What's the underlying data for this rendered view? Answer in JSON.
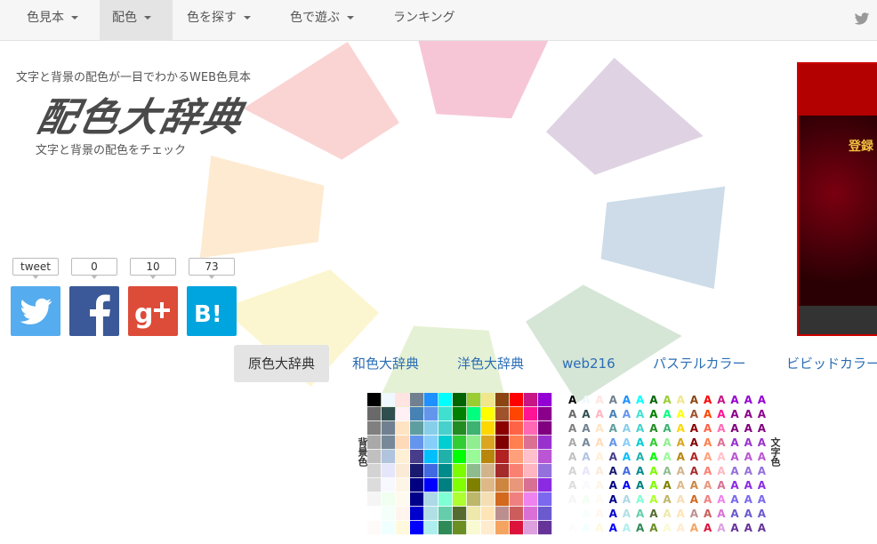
{
  "nav": {
    "items": [
      {
        "label": "色見本",
        "dropdown": true
      },
      {
        "label": "配色",
        "dropdown": true,
        "active": true
      },
      {
        "label": "色を探す",
        "dropdown": true
      },
      {
        "label": "色で遊ぶ",
        "dropdown": true
      },
      {
        "label": "ランキング",
        "dropdown": false
      }
    ],
    "right_icon": "twitter-icon"
  },
  "header": {
    "tagline": "文字と背景の配色が一目でわかるWEB色見本",
    "logo": "配色大辞典",
    "subtitle": "文字と背景の配色をチェック"
  },
  "social": [
    {
      "label": "tweet",
      "icon": "twitter-icon",
      "color": "#55acee"
    },
    {
      "label": "0",
      "icon": "facebook-icon",
      "color": "#3b5998"
    },
    {
      "label": "10",
      "icon": "google-plus-icon",
      "color": "#dd4b39"
    },
    {
      "label": "73",
      "icon": "hatena-bookmark-icon",
      "color": "#00a4de"
    }
  ],
  "tabs": [
    {
      "label": "原色大辞典",
      "active": true
    },
    {
      "label": "和色大辞典"
    },
    {
      "label": "洋色大辞典"
    },
    {
      "label": "web216"
    },
    {
      "label": "パステルカラー"
    },
    {
      "label": "ビビッドカラー"
    }
  ],
  "palette": {
    "background_label": "背景色",
    "text_label": "文字色",
    "sample_char": "A",
    "columns": [
      [
        "#000000",
        "#696969",
        "#808080",
        "#a9a9a9",
        "#c0c0c0",
        "#d3d3d3",
        "#dcdcdc",
        "#f5f5f5",
        "#ffffff",
        "#fffafa"
      ],
      [
        "#f0f8ff",
        "#2f4f4f",
        "#708090",
        "#778899",
        "#b0c4de",
        "#e6e6fa",
        "#f8f8ff",
        "#f0fff0",
        "#f5fffa",
        "#f0ffff"
      ],
      [
        "#ffe4e1",
        "#fff0f5",
        "#ffe4c4",
        "#ffdab9",
        "#ffefd5",
        "#faebd7",
        "#fdf5e6",
        "#fffaf0",
        "#fff5ee",
        "#fff8dc"
      ],
      [
        "#708090",
        "#4682b4",
        "#5f9ea0",
        "#6495ed",
        "#483d8b",
        "#191970",
        "#000080",
        "#00008b",
        "#0000cd",
        "#0000ff"
      ],
      [
        "#1e90ff",
        "#6495ed",
        "#87ceeb",
        "#87cefa",
        "#00bfff",
        "#4169e1",
        "#0000ff",
        "#add8e6",
        "#b0e0e6",
        "#afeeee"
      ],
      [
        "#00ffff",
        "#40e0d0",
        "#48d1cc",
        "#00ced1",
        "#20b2aa",
        "#008b8b",
        "#008080",
        "#7fffd4",
        "#66cdaa",
        "#2e8b57"
      ],
      [
        "#006400",
        "#008000",
        "#228b22",
        "#32cd32",
        "#00ff00",
        "#7cfc00",
        "#7fff00",
        "#adff2f",
        "#556b2f",
        "#6b8e23"
      ],
      [
        "#9acd32",
        "#00ff7f",
        "#3cb371",
        "#90ee90",
        "#98fb98",
        "#8fbc8f",
        "#808000",
        "#bdb76b",
        "#eee8aa",
        "#fafad2"
      ],
      [
        "#f0e68c",
        "#ffff00",
        "#ffd700",
        "#daa520",
        "#b8860b",
        "#d2b48c",
        "#deb887",
        "#f5deb3",
        "#ffe4b5",
        "#ffebcd"
      ],
      [
        "#8b4513",
        "#a0522d",
        "#8b0000",
        "#800000",
        "#b22222",
        "#a52a2a",
        "#cd853f",
        "#d2691e",
        "#bc8f8f",
        "#f4a460"
      ],
      [
        "#ff0000",
        "#ff4500",
        "#ff6347",
        "#ff7f50",
        "#ffa07a",
        "#fa8072",
        "#e9967a",
        "#f08080",
        "#cd5c5c",
        "#dc143c"
      ],
      [
        "#c71585",
        "#ff1493",
        "#ff69b4",
        "#db7093",
        "#ffc0cb",
        "#ffb6c1",
        "#d87093",
        "#ee82ee",
        "#da70d6",
        "#dda0dd"
      ],
      [
        "#9400d3",
        "#8b008b",
        "#800080",
        "#9932cc",
        "#ba55d3",
        "#9370db",
        "#8a2be2",
        "#7b68ee",
        "#6a5acd",
        "#663399"
      ]
    ],
    "text_colors": [
      [
        "#000000",
        "#696969",
        "#808080",
        "#a9a9a9",
        "#c0c0c0",
        "#d3d3d3",
        "#dcdcdc",
        "#f5f5f5",
        "#ffffff",
        "#fffafa"
      ],
      [
        "#f0f8ff",
        "#2f4f4f",
        "#708090",
        "#778899",
        "#b0c4de",
        "#e6e6fa",
        "#f8f8ff",
        "#f0fff0",
        "#f5fffa",
        "#f0ffff"
      ],
      [
        "#ffe4e1",
        "#ffb6c1",
        "#ffe4c4",
        "#ffdab9",
        "#ffefd5",
        "#faebd7",
        "#fdf5e6",
        "#fffaf0",
        "#fff5ee",
        "#fff8dc"
      ],
      [
        "#708090",
        "#4682b4",
        "#5f9ea0",
        "#6495ed",
        "#483d8b",
        "#191970",
        "#000080",
        "#00008b",
        "#0000cd",
        "#0000ff"
      ],
      [
        "#1e90ff",
        "#6495ed",
        "#87ceeb",
        "#87cefa",
        "#00bfff",
        "#4169e1",
        "#0000ff",
        "#add8e6",
        "#b0e0e6",
        "#afeeee"
      ],
      [
        "#00ffff",
        "#40e0d0",
        "#48d1cc",
        "#00ced1",
        "#20b2aa",
        "#008b8b",
        "#008080",
        "#7fffd4",
        "#66cdaa",
        "#2e8b57"
      ],
      [
        "#006400",
        "#008000",
        "#228b22",
        "#32cd32",
        "#00ff00",
        "#7cfc00",
        "#7fff00",
        "#adff2f",
        "#556b2f",
        "#6b8e23"
      ],
      [
        "#9acd32",
        "#00ff7f",
        "#3cb371",
        "#90ee90",
        "#98fb98",
        "#8fbc8f",
        "#808000",
        "#bdb76b",
        "#eee8aa",
        "#fafad2"
      ],
      [
        "#f0e68c",
        "#ffff00",
        "#ffd700",
        "#daa520",
        "#b8860b",
        "#d2b48c",
        "#deb887",
        "#f5deb3",
        "#ffe4b5",
        "#ffebcd"
      ],
      [
        "#8b4513",
        "#a0522d",
        "#8b0000",
        "#800000",
        "#b22222",
        "#a52a2a",
        "#cd853f",
        "#d2691e",
        "#bc8f8f",
        "#f4a460"
      ],
      [
        "#ff0000",
        "#ff4500",
        "#ff6347",
        "#ff7f50",
        "#ffa07a",
        "#fa8072",
        "#e9967a",
        "#f08080",
        "#cd5c5c",
        "#dc143c"
      ],
      [
        "#c71585",
        "#ff1493",
        "#ff69b4",
        "#db7093",
        "#ffc0cb",
        "#ffb6c1",
        "#d87093",
        "#ee82ee",
        "#da70d6",
        "#dda0dd"
      ],
      [
        "#9400d3",
        "#8b008b",
        "#800080",
        "#9932cc",
        "#ba55d3",
        "#9370db",
        "#8a2be2",
        "#7b68ee",
        "#6a5acd",
        "#663399"
      ],
      [
        "#9400d3",
        "#8b008b",
        "#800080",
        "#9932cc",
        "#ba55d3",
        "#9370db",
        "#8a2be2",
        "#7b68ee",
        "#6a5acd",
        "#663399"
      ],
      [
        "#9400d3",
        "#8b008b",
        "#800080",
        "#9932cc",
        "#ba55d3",
        "#9370db",
        "#8a2be2",
        "#7b68ee",
        "#6a5acd",
        "#663399"
      ]
    ]
  },
  "wheel_colors": [
    "#f3b3c9",
    "#d4c4d9",
    "#bcd0e0",
    "#c7dcc8",
    "#dcecc5",
    "#fbf3c0",
    "#fde3c0",
    "#f8c6c4"
  ],
  "banner": {
    "text": "登録"
  }
}
